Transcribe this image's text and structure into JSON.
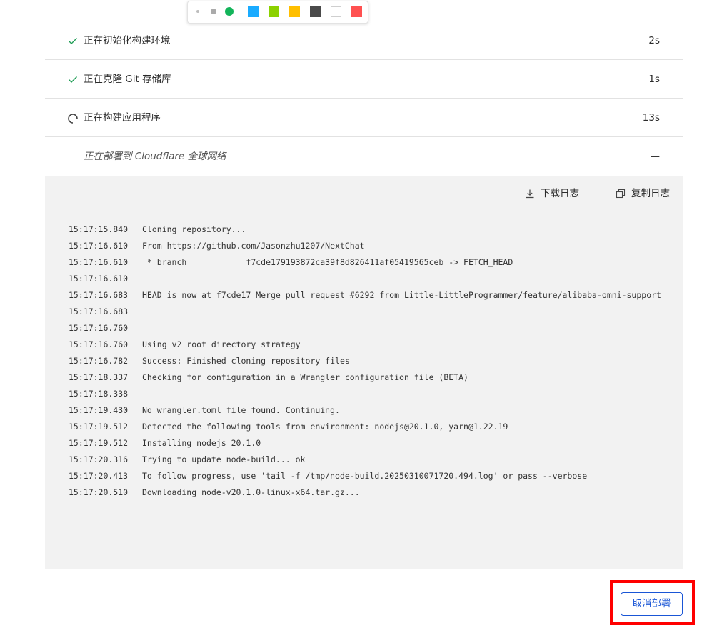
{
  "toolbar": {
    "swatches": [
      "#1aabff",
      "#8cd100",
      "#ffbf00",
      "#4a4a4a",
      "#ffffff",
      "#ff5151"
    ],
    "dot_colors": [
      "#bdbdbd",
      "#aaaaaa",
      "#13b45a"
    ]
  },
  "steps": [
    {
      "label": "正在初始化构建环境",
      "duration": "2s",
      "status": "done"
    },
    {
      "label": "正在克隆 Git 存储库",
      "duration": "1s",
      "status": "done"
    },
    {
      "label": "正在构建应用程序",
      "duration": "13s",
      "status": "running"
    },
    {
      "label": "正在部署到 Cloudflare 全球网络",
      "duration": "—",
      "status": "pending"
    }
  ],
  "log_actions": {
    "download": "下载日志",
    "copy": "复制日志"
  },
  "log": [
    {
      "time": "15:17:15.840",
      "text": "Cloning repository..."
    },
    {
      "time": "15:17:16.610",
      "text": "From https://github.com/Jasonzhu1207/NextChat"
    },
    {
      "time": "15:17:16.610",
      "text": " * branch            f7cde179193872ca39f8d826411af05419565ceb -> FETCH_HEAD"
    },
    {
      "time": "15:17:16.610",
      "text": ""
    },
    {
      "time": "15:17:16.683",
      "text": "HEAD is now at f7cde17 Merge pull request #6292 from Little-LittleProgrammer/feature/alibaba-omni-support"
    },
    {
      "time": "15:17:16.683",
      "text": ""
    },
    {
      "time": "15:17:16.760",
      "text": ""
    },
    {
      "time": "15:17:16.760",
      "text": "Using v2 root directory strategy"
    },
    {
      "time": "15:17:16.782",
      "text": "Success: Finished cloning repository files"
    },
    {
      "time": "15:17:18.337",
      "text": "Checking for configuration in a Wrangler configuration file (BETA)"
    },
    {
      "time": "15:17:18.338",
      "text": ""
    },
    {
      "time": "15:17:19.430",
      "text": "No wrangler.toml file found. Continuing."
    },
    {
      "time": "15:17:19.512",
      "text": "Detected the following tools from environment: nodejs@20.1.0, yarn@1.22.19"
    },
    {
      "time": "15:17:19.512",
      "text": "Installing nodejs 20.1.0"
    },
    {
      "time": "15:17:20.316",
      "text": "Trying to update node-build... ok"
    },
    {
      "time": "15:17:20.413",
      "text": "To follow progress, use 'tail -f /tmp/node-build.20250310071720.494.log' or pass --verbose"
    },
    {
      "time": "15:17:20.510",
      "text": "Downloading node-v20.1.0-linux-x64.tar.gz..."
    }
  ],
  "cancel_label": "取消部署",
  "colors": {
    "accent": "#1a56d6",
    "success": "#1f9d55",
    "highlight": "#ff0000"
  }
}
